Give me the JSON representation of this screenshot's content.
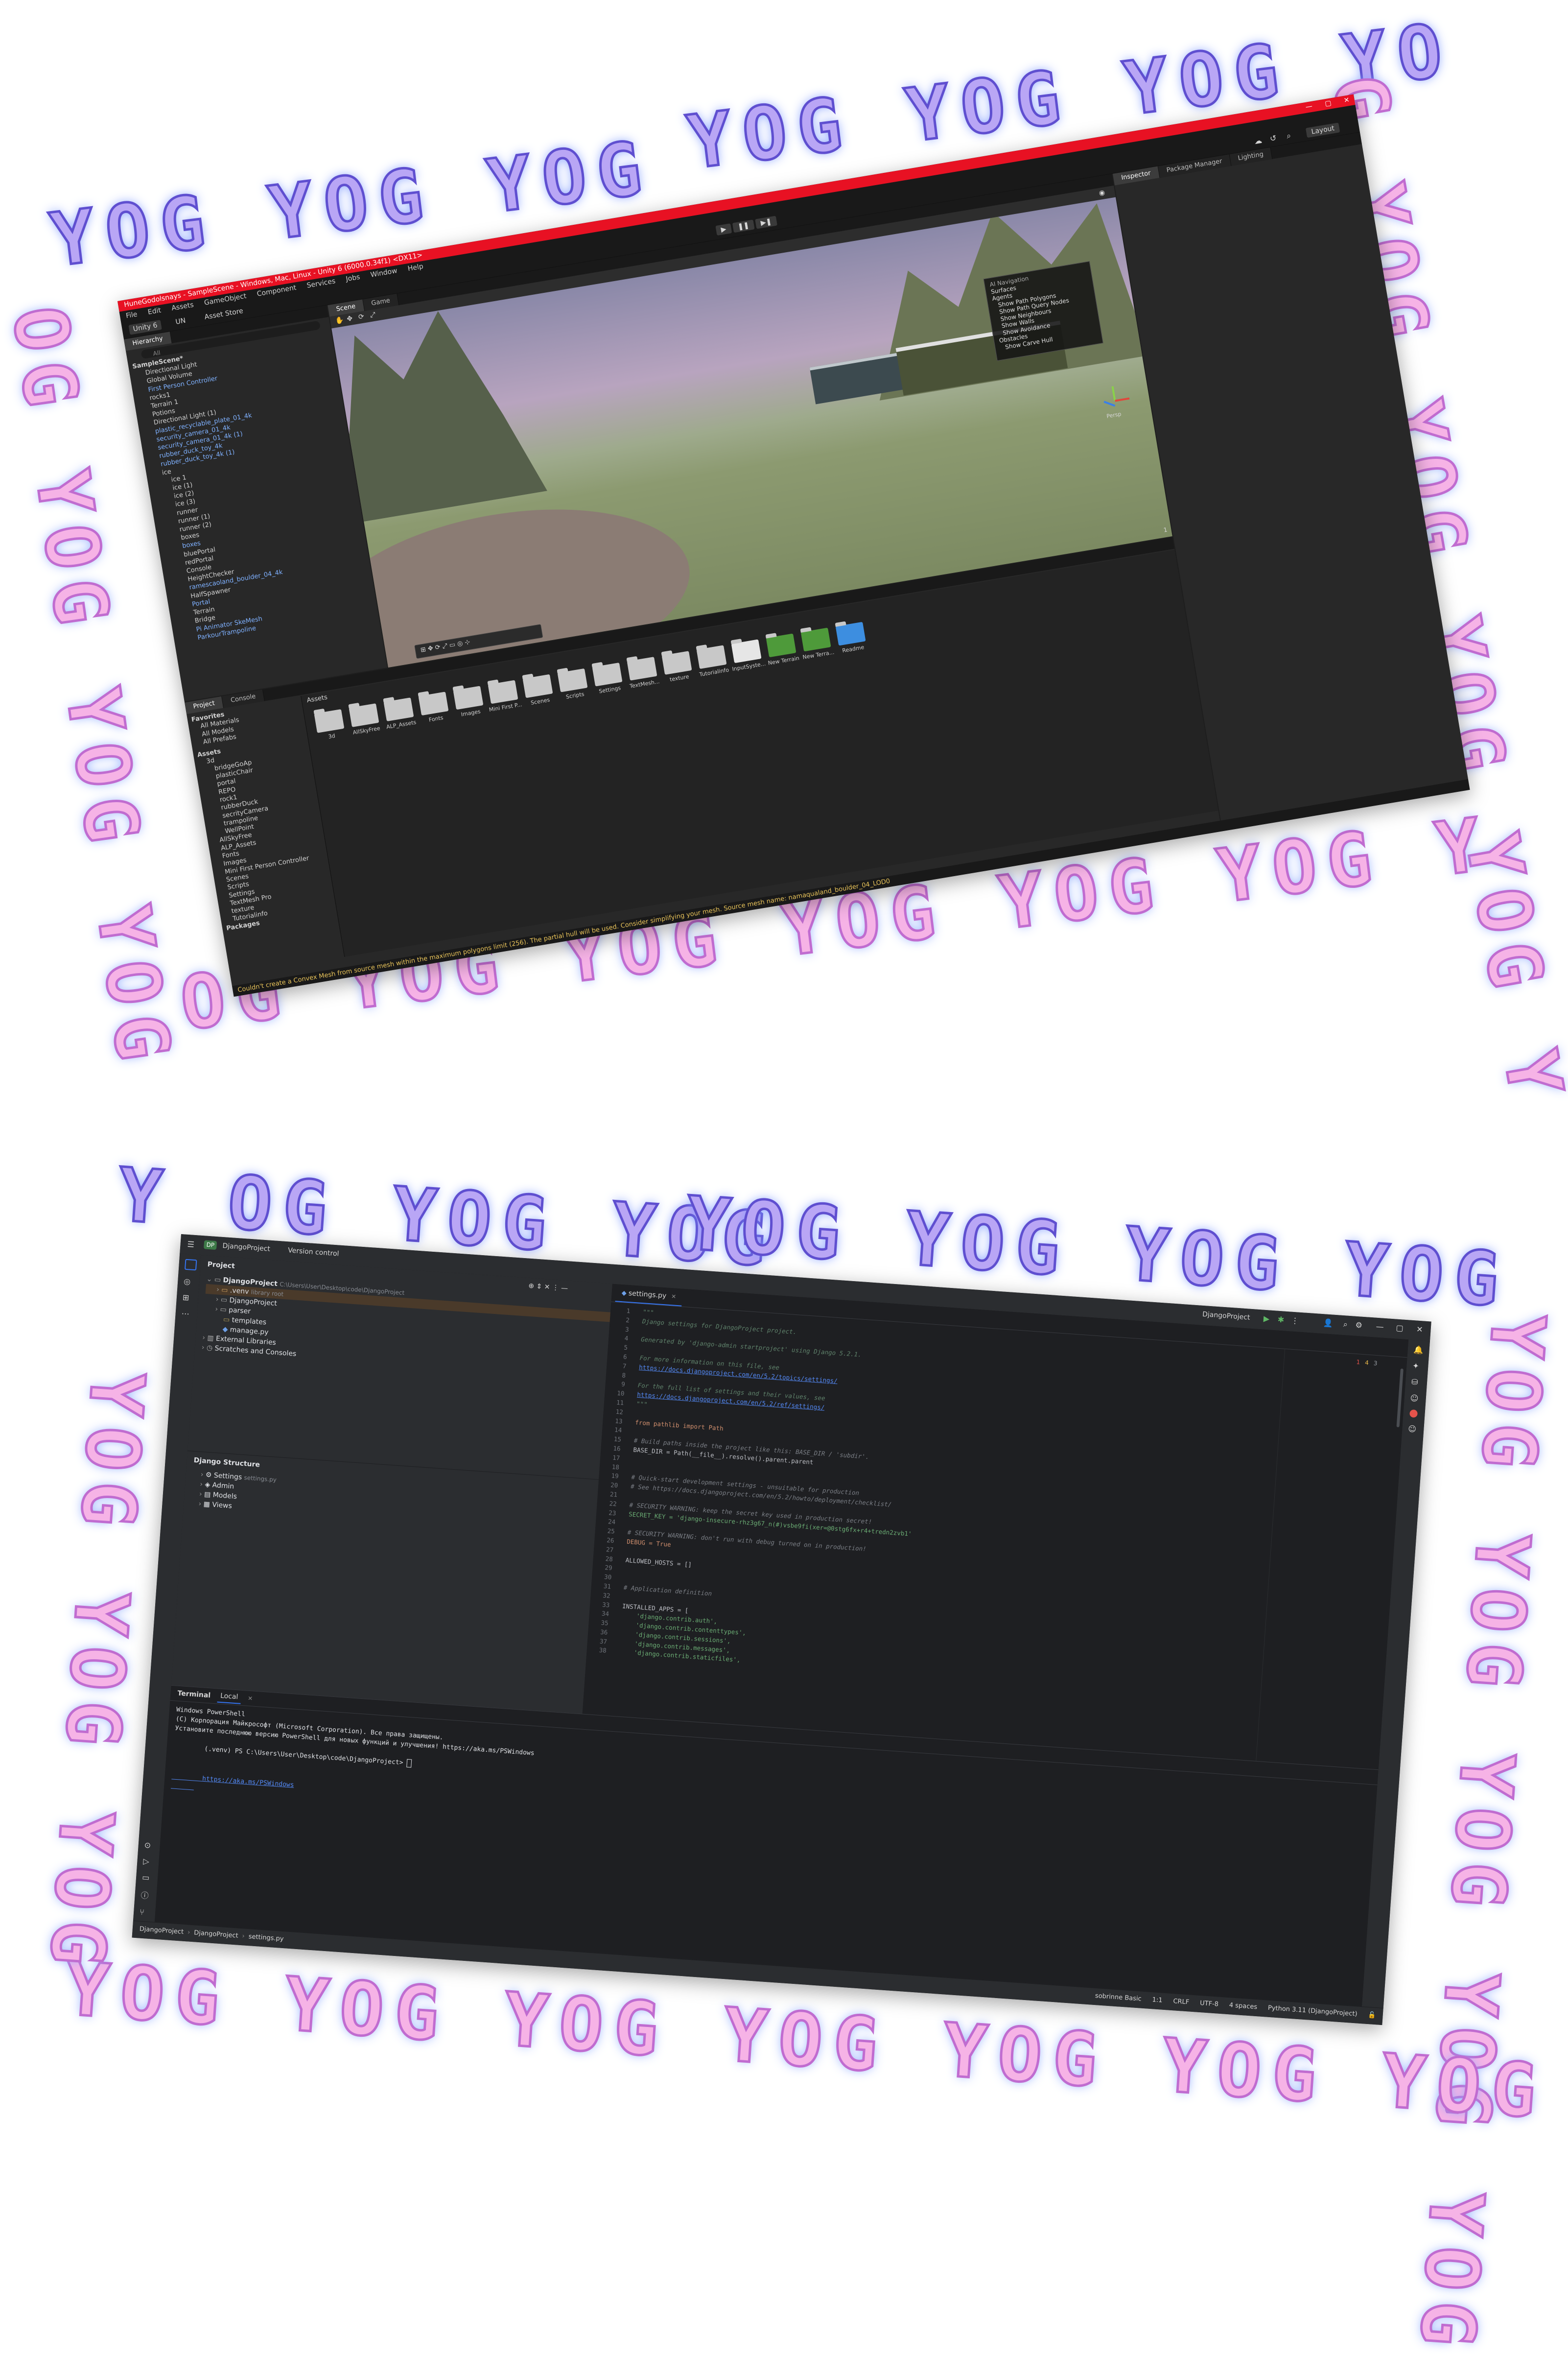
{
  "decoration": {
    "phrase_top_1": "YOG YOG YOG",
    "phrase_top_2": "YOG YOG YOG YO",
    "phrase_right_1": "G YOG YOG YOG YOG Y",
    "phrase_bottom_1": "OG YOG YOG YOG YOG YOG Y",
    "phrase_left_1": "OG YOG YOG YOG",
    "phrase_top_3": "Y OG YOG YOG",
    "phrase_top_4": "YOG YOG YOG YOG",
    "phrase_right_2": "YOG YOG YOG YOG YOG",
    "phrase_bottom_2": "YOG YOG YOG YOG YOG YOG YOG",
    "phrase_left_2": "YOG YOG YOG"
  },
  "unity": {
    "window_title": "HuneGodolsnays - SampleScene - Windows, Mac, Linux - Unity 6 (6000.0.34f1) <DX11>",
    "window_buttons": [
      "—",
      "▢",
      "✕"
    ],
    "menu": [
      "File",
      "Edit",
      "Assets",
      "GameObject",
      "Component",
      "Services",
      "Jobs",
      "Window",
      "Help"
    ],
    "toolbar": {
      "account": "Unity 6",
      "cloud": "UN",
      "asset_store": "Asset Store",
      "layout": "Layout"
    },
    "play_controls": [
      "▶",
      "❚❚",
      "▶❚"
    ],
    "hierarchy": {
      "tab": "Hierarchy",
      "search_placeholder": "All",
      "items": [
        "SampleScene*",
        "Directional Light",
        "Global Volume",
        "First Person Controller",
        "rocks1",
        "Terrain 1",
        "Potions",
        "Directional Light (1)",
        "plastic_recyclable_plate_01_4k",
        "security_camera_01_4k",
        "security_camera_01_4k (1)",
        "rubber_duck_toy_4k",
        "rubber_duck_toy_4k (1)",
        "ice",
        "ice 1",
        "ice (1)",
        "ice (2)",
        "ice (3)",
        "runner",
        "runner (1)",
        "runner (2)",
        "boxes",
        "boxes",
        "bluePortal",
        "redPortal",
        "Console",
        "HeightChecker",
        "ramescaoland_boulder_04_4k",
        "HalfSpawner",
        "Portal",
        "Terrain",
        "Bridge",
        "Pi Animator SkeMesh",
        "ParkourTrampoline"
      ]
    },
    "scene": {
      "tabs": [
        "Scene",
        "Game"
      ],
      "nav_overlay": {
        "title": "AI Navigation",
        "items": [
          "Surfaces",
          "Agents",
          "Show Path Polygons",
          "Show Path Query Nodes",
          "Show Neighbours",
          "Show Walls",
          "Show Avoidance",
          "Obstacles",
          "Show Carve Hull"
        ]
      },
      "gizmo_label": "Persp",
      "status_value": "1"
    },
    "inspector": {
      "tabs": [
        "Inspector",
        "Package Manager",
        "Lighting"
      ]
    },
    "project": {
      "tabs": [
        "Project",
        "Console"
      ],
      "favorites_title": "Favorites",
      "favorites": [
        "All Materials",
        "All Models",
        "All Prefabs"
      ],
      "assets_title": "Assets",
      "tree": [
        "3d",
        "bridgeGoAp",
        "plasticChair",
        "portal",
        "REPO",
        "rock1",
        "rubberDuck",
        "secrityCamera",
        "trampoline",
        "WellPoint",
        "AllSkyFree",
        "ALP_Assets",
        "Fonts",
        "Images",
        "Mini First Person Controller",
        "Scenes",
        "Scripts",
        "Settings",
        "TextMesh Pro",
        "texture",
        "Tutorialinfo",
        "Packages"
      ],
      "breadcrumb": "Assets",
      "grid_row1": [
        "3d",
        "AllSkyFree",
        "ALP_Assets",
        "Fonts",
        "Images",
        "Mini First P...",
        "Scenes",
        "Scripts",
        "Settings",
        "TextMesh...",
        "texture",
        "Tutorialinfo",
        "InputSyste...",
        "New Terrain",
        "New Terra...",
        "Readme"
      ]
    },
    "status_warning": "Couldn't create a Convex Mesh from source mesh within the maximum polygons limit (256). The partial hull will be used. Consider simplifying your mesh. Source mesh name: namaqualand_boulder_04_LOD0"
  },
  "pycharm": {
    "project_badge": "DP",
    "project_name": "DjangoProject",
    "vcs": "Version control",
    "run_config": "DjangoProject",
    "project_panel": {
      "title": "Project",
      "tree": [
        {
          "label": "DjangoProject",
          "note": "C:\\Users\\User\\Desktop\\code\\DjangoProject"
        },
        {
          "label": ".venv",
          "note": "library root"
        },
        {
          "label": "DjangoProject",
          "note": ""
        },
        {
          "label": "parser",
          "note": ""
        },
        {
          "label": "templates",
          "note": ""
        },
        {
          "label": "manage.py",
          "note": ""
        },
        {
          "label": "External Libraries",
          "note": ""
        },
        {
          "label": "Scratches and Consoles",
          "note": ""
        }
      ]
    },
    "structure": {
      "title": "Django Structure",
      "items": [
        {
          "label": "Settings",
          "note": "settings.py"
        },
        {
          "label": "Admin",
          "note": ""
        },
        {
          "label": "Models",
          "note": ""
        },
        {
          "label": "Views",
          "note": ""
        }
      ]
    },
    "editor": {
      "tab": "settings.py",
      "inspections": {
        "errors": "1",
        "warnings": "4",
        "weak": "3"
      },
      "lines": [
        "\"\"\"",
        "Django settings for DjangoProject project.",
        "",
        "Generated by 'django-admin startproject' using Django 5.2.1.",
        "",
        "For more information on this file, see",
        "https://docs.djangoproject.com/en/5.2/topics/settings/",
        "",
        "For the full list of settings and their values, see",
        "https://docs.djangoproject.com/en/5.2/ref/settings/",
        "\"\"\"",
        "",
        "from pathlib import Path",
        "",
        "# Build paths inside the project like this: BASE_DIR / 'subdir'.",
        "BASE_DIR = Path(__file__).resolve().parent.parent",
        "",
        "",
        "# Quick-start development settings - unsuitable for production",
        "# See https://docs.djangoproject.com/en/5.2/howto/deployment/checklist/",
        "",
        "# SECURITY WARNING: keep the secret key used in production secret!",
        "SECRET_KEY = 'django-insecure-rhz3g67_n(#)vsbe9fi(xer=@0stg6fx+r4+tredn2zvb1'",
        "",
        "# SECURITY WARNING: don't run with debug turned on in production!",
        "DEBUG = True",
        "",
        "ALLOWED_HOSTS = []",
        "",
        "",
        "# Application definition",
        "",
        "INSTALLED_APPS = [",
        "    'django.contrib.auth',",
        "    'django.contrib.contenttypes',",
        "    'django.contrib.sessions',",
        "    'django.contrib.messages',",
        "    'django.contrib.staticfiles',"
      ]
    },
    "terminal": {
      "tabs": [
        "Terminal",
        "Local"
      ],
      "lines": [
        "Windows PowerShell",
        "(C) Корпорация Майкрософт (Microsoft Corporation). Все права защищены.",
        "",
        "Установите последнюю версию PowerShell для новых функций и улучшения! https://aka.ms/PSWindows",
        "",
        "(.venv) PS C:\\Users\\User\\Desktop\\code\\DjangoProject> "
      ],
      "link": "https://aka.ms/PSWindows"
    },
    "breadcrumb": [
      "DjangoProject",
      "DjangoProject",
      "settings.py"
    ],
    "status": {
      "theme": "sobrinne Basic",
      "position": "1:1",
      "line_sep": "CRLF",
      "encoding": "UTF-8",
      "indent": "4 spaces",
      "interpreter": "Python 3.11 (DjangoProject)"
    }
  }
}
